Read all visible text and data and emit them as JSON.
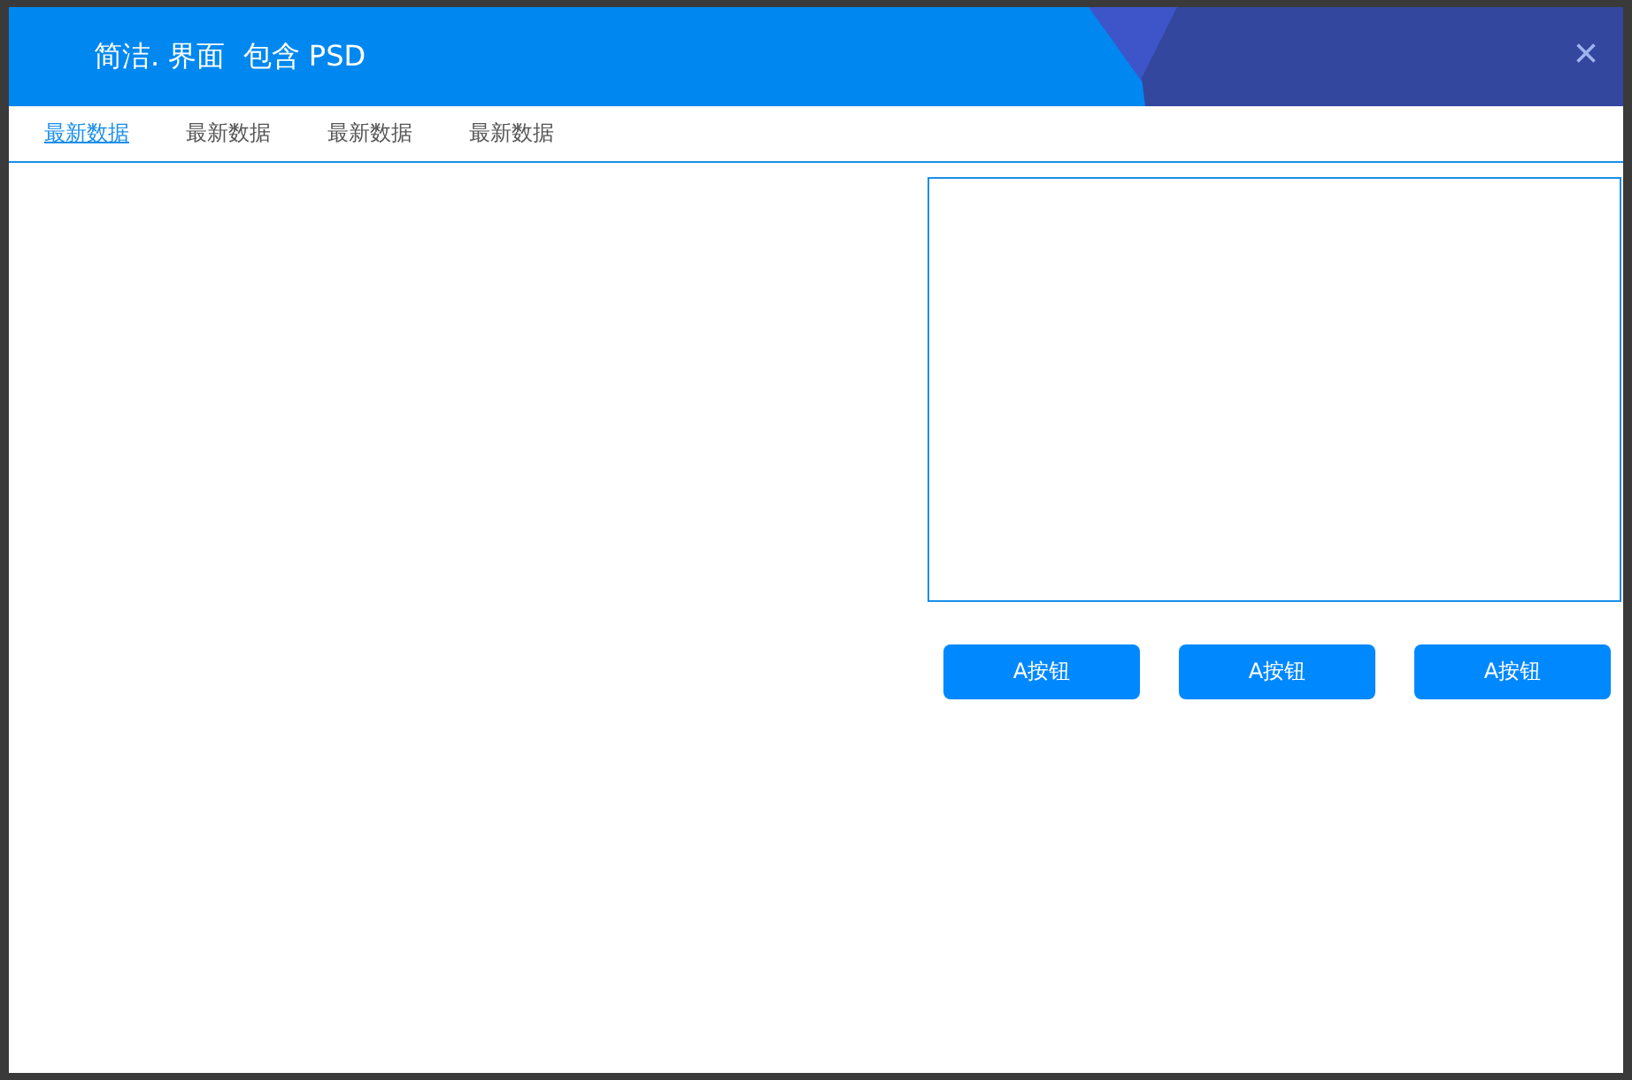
{
  "window": {
    "title": "简洁. 界面  包含 PSD",
    "close": "×"
  },
  "tabs": [
    {
      "label": "最新数据",
      "selected": true
    },
    {
      "label": "最新数据",
      "selected": false
    },
    {
      "label": "最新数据",
      "selected": false
    },
    {
      "label": "最新数据",
      "selected": false
    }
  ],
  "buttons": [
    "A按钮",
    "A按钮",
    "A按钮"
  ]
}
